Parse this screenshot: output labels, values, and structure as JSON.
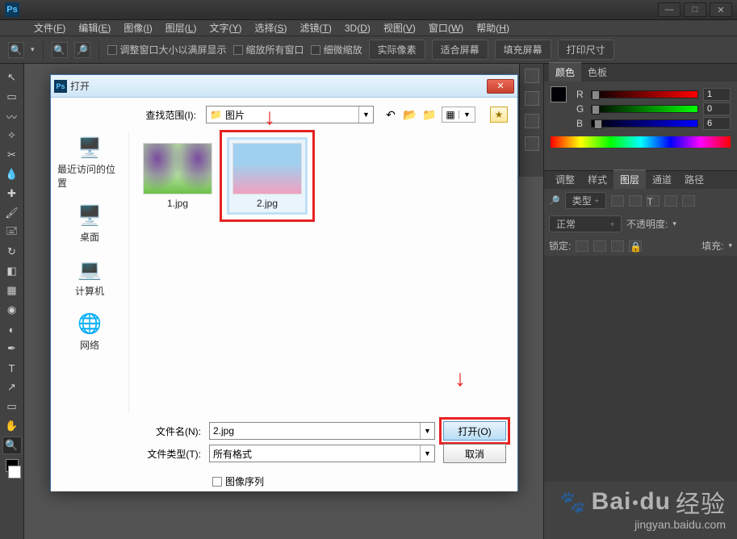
{
  "app": {
    "name": "Ps"
  },
  "window_controls": {
    "min": "—",
    "max": "□",
    "close": "✕"
  },
  "menubar": [
    {
      "label": "文件",
      "hotkey": "F"
    },
    {
      "label": "编辑",
      "hotkey": "E"
    },
    {
      "label": "图像",
      "hotkey": "I"
    },
    {
      "label": "图层",
      "hotkey": "L"
    },
    {
      "label": "文字",
      "hotkey": "Y"
    },
    {
      "label": "选择",
      "hotkey": "S"
    },
    {
      "label": "滤镜",
      "hotkey": "T"
    },
    {
      "label": "3D",
      "hotkey": "D"
    },
    {
      "label": "视图",
      "hotkey": "V"
    },
    {
      "label": "窗口",
      "hotkey": "W"
    },
    {
      "label": "帮助",
      "hotkey": "H"
    }
  ],
  "optionbar": {
    "check1": "调整窗口大小以满屏显示",
    "check2": "缩放所有窗口",
    "check3": "细微缩放",
    "btn1": "实际像素",
    "btn2": "适合屏幕",
    "btn3": "填充屏幕",
    "btn4": "打印尺寸"
  },
  "color_panel": {
    "tabs": {
      "color": "颜色",
      "swatches": "色板"
    },
    "channels": [
      {
        "label": "R",
        "value": "1",
        "pos": 0
      },
      {
        "label": "G",
        "value": "0",
        "pos": 0
      },
      {
        "label": "B",
        "value": "6",
        "pos": 2
      }
    ],
    "fg": "#010006",
    "bg": "#ffffff"
  },
  "layers_panel": {
    "tabs": {
      "adjust": "调整",
      "styles": "样式",
      "layers": "图层",
      "channels": "通道",
      "paths": "路径"
    },
    "filter": "类型",
    "blend": "正常",
    "opacity_label": "不透明度:",
    "lock_label": "锁定:",
    "fill_label": "填充:"
  },
  "dialog": {
    "title": "打开",
    "lookup_label": "查找范围(I):",
    "current_folder": "图片",
    "sidebar": [
      {
        "label": "最近访问的位置",
        "icon": "🖥️"
      },
      {
        "label": "桌面",
        "icon": "🖥️"
      },
      {
        "label": "计算机",
        "icon": "💻"
      },
      {
        "label": "网络",
        "icon": "🌐"
      }
    ],
    "files": [
      {
        "name": "1.jpg",
        "selected": false
      },
      {
        "name": "2.jpg",
        "selected": true
      }
    ],
    "filename_label": "文件名(N):",
    "filename_value": "2.jpg",
    "filetype_label": "文件类型(T):",
    "filetype_value": "所有格式",
    "open_btn": "打开(O)",
    "cancel_btn": "取消",
    "sequence_label": "图像序列"
  },
  "watermark": {
    "brand_a": "Bai",
    "brand_b": "du",
    "brand_c": "经验",
    "url": "jingyan.baidu.com"
  }
}
